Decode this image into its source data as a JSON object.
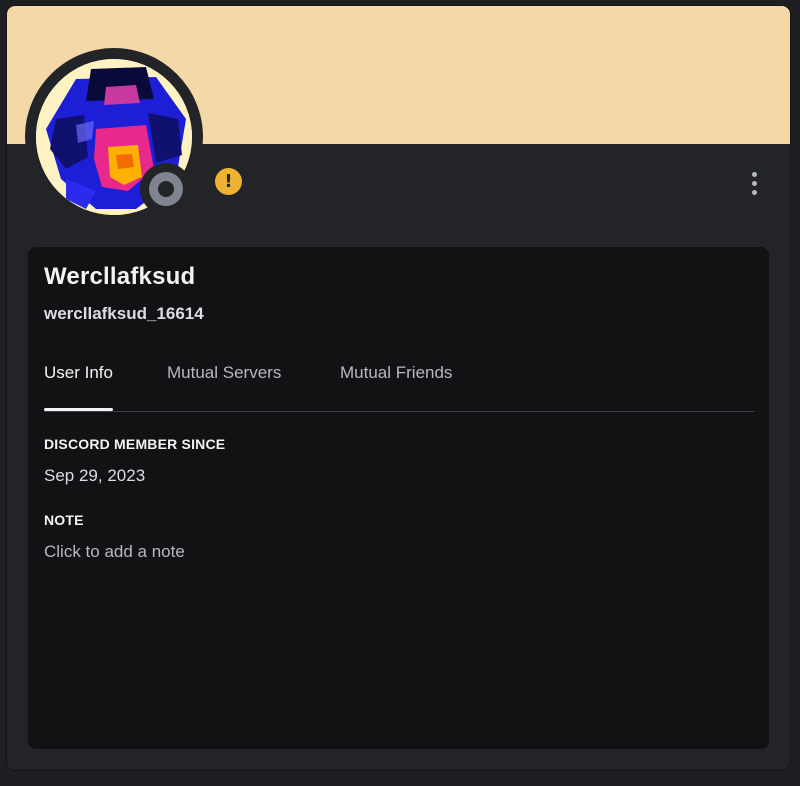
{
  "profile": {
    "display_name": "Wercllafksud",
    "username": "wercllafksud_16614",
    "status": "offline",
    "banner_color": "#f5d8a8",
    "warning_icon": "exclamation-icon",
    "warning_glyph": "!",
    "more_icon": "more-vertical-icon"
  },
  "tabs": [
    {
      "label": "User Info",
      "active": true
    },
    {
      "label": "Mutual Servers",
      "active": false
    },
    {
      "label": "Mutual Friends",
      "active": false
    }
  ],
  "user_info": {
    "member_since_title": "DISCORD MEMBER SINCE",
    "member_since_value": "Sep 29, 2023",
    "note_title": "NOTE",
    "note_placeholder": "Click to add a note"
  },
  "colors": {
    "accent_warning": "#f0b232",
    "status_offline": "#80848e",
    "panel_bg": "#111214",
    "modal_bg": "#232428"
  }
}
